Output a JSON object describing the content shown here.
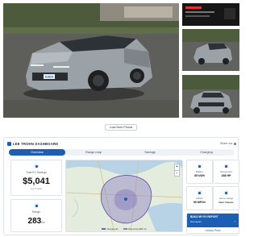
{
  "gallery": {
    "photos": [
      "main-photo",
      "thumb-1",
      "thumb-2",
      "thumb-3"
    ],
    "badge": "KADA",
    "load_more_label": "Load More Photos"
  },
  "dashboard": {
    "title": "LEE TROHN DASHBOARD",
    "share_label": "Share via",
    "tabs": [
      {
        "label": "Overview",
        "active": true
      },
      {
        "label": "Range map",
        "active": false
      },
      {
        "label": "Savings",
        "active": false
      },
      {
        "label": "Charging",
        "active": false
      }
    ],
    "savings": {
      "label": "Total EV Savings",
      "value": "$5,041",
      "sub": "over 5 years"
    },
    "range": {
      "label": "Range",
      "value": "283",
      "unit": "mi"
    },
    "map_legend": [
      "Charge only",
      "Round-trip (283 mi)"
    ],
    "zoom": [
      "+",
      "−"
    ],
    "stats": [
      {
        "label": "Battery",
        "value": "85 kWh",
        "sub": ""
      },
      {
        "label": "Horsepower",
        "value": "288 HP",
        "sub": ""
      },
      {
        "label": "MPGe",
        "value": "99 MPGe",
        "sub": ""
      },
      {
        "label": "Home charge",
        "value": "Over 4 Hours",
        "sub": ""
      }
    ],
    "report": {
      "title": "BUILD MY EV REPORT",
      "subtitle": "Get report",
      "button": "Unlock Price"
    }
  },
  "colors": {
    "primary": "#1a5fb4",
    "vehicle_body": "#9aa1a7",
    "map_range_fill": "#8b7fc4"
  }
}
